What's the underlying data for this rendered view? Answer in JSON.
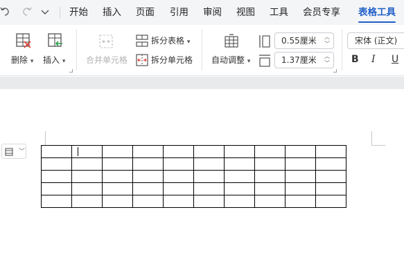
{
  "quick_access": {
    "undo_icon": "undo-arrow-icon",
    "redo_icon": "redo-arrow-icon",
    "more_icon": "chevron-down-icon"
  },
  "tabs": [
    {
      "label": "开始"
    },
    {
      "label": "插入"
    },
    {
      "label": "页面"
    },
    {
      "label": "引用"
    },
    {
      "label": "审阅"
    },
    {
      "label": "视图"
    },
    {
      "label": "工具"
    },
    {
      "label": "会员专享"
    },
    {
      "label": "表格工具",
      "active": true
    }
  ],
  "ribbon": {
    "delete_label": "删除",
    "insert_label": "插入",
    "merge_cells_label": "合并单元格",
    "split_table_label": "拆分表格",
    "split_cells_label": "拆分单元格",
    "autofit_label": "自动调整",
    "row_height_value": "0.55厘米",
    "col_width_value": "1.37厘米",
    "font_name_value": "宋体 (正文)",
    "bold_label": "B",
    "italic_label": "I",
    "underline_label": "U"
  },
  "table": {
    "rows": 5,
    "cols": 10,
    "cursor_cell": [
      0,
      1
    ]
  },
  "colors": {
    "accent": "#1f5fc8",
    "tabbar_bg": "#f4f5f7",
    "delete_red": "#e0443b"
  }
}
